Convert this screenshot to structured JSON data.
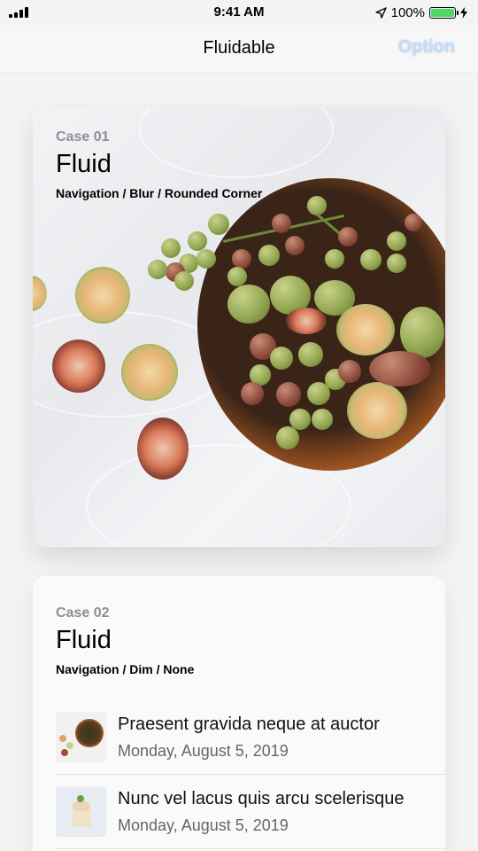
{
  "status": {
    "time": "9:41 AM",
    "battery": "100%",
    "battery_level": 1.0
  },
  "nav": {
    "title": "Fluidable",
    "option": "Option"
  },
  "cards": [
    {
      "case": "Case 01",
      "title": "Fluid",
      "subtitle": "Navigation / Blur / Rounded Corner"
    },
    {
      "case": "Case 02",
      "title": "Fluid",
      "subtitle": "Navigation / Dim / None"
    }
  ],
  "list": [
    {
      "title": "Praesent gravida neque at auctor",
      "date": "Monday, August 5, 2019"
    },
    {
      "title": "Nunc vel lacus quis arcu scelerisque",
      "date": "Monday, August 5, 2019"
    }
  ],
  "icons": {
    "signal": "signal-bars-icon",
    "location": "location-arrow-icon",
    "battery": "battery-icon",
    "charging": "charging-bolt-icon"
  },
  "colors": {
    "accent": "#c9dcf2",
    "battery_green": "#4cd964",
    "case_label": "#8e8e93"
  }
}
